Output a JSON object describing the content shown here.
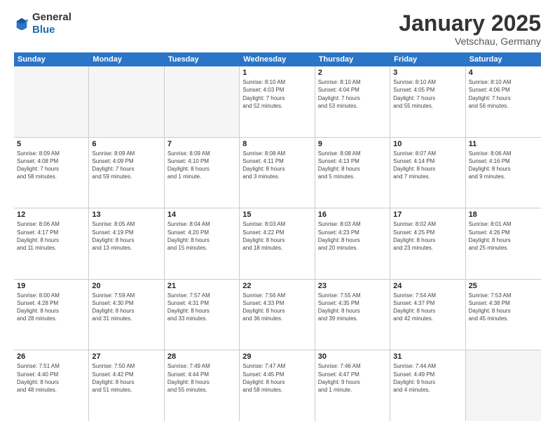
{
  "header": {
    "logo": {
      "general": "General",
      "blue": "Blue"
    },
    "title": "January 2025",
    "location": "Vetschau, Germany"
  },
  "calendar": {
    "weekdays": [
      "Sunday",
      "Monday",
      "Tuesday",
      "Wednesday",
      "Thursday",
      "Friday",
      "Saturday"
    ],
    "rows": [
      [
        {
          "day": "",
          "info": ""
        },
        {
          "day": "",
          "info": ""
        },
        {
          "day": "",
          "info": ""
        },
        {
          "day": "1",
          "info": "Sunrise: 8:10 AM\nSunset: 4:03 PM\nDaylight: 7 hours\nand 52 minutes."
        },
        {
          "day": "2",
          "info": "Sunrise: 8:10 AM\nSunset: 4:04 PM\nDaylight: 7 hours\nand 53 minutes."
        },
        {
          "day": "3",
          "info": "Sunrise: 8:10 AM\nSunset: 4:05 PM\nDaylight: 7 hours\nand 55 minutes."
        },
        {
          "day": "4",
          "info": "Sunrise: 8:10 AM\nSunset: 4:06 PM\nDaylight: 7 hours\nand 56 minutes."
        }
      ],
      [
        {
          "day": "5",
          "info": "Sunrise: 8:09 AM\nSunset: 4:08 PM\nDaylight: 7 hours\nand 58 minutes."
        },
        {
          "day": "6",
          "info": "Sunrise: 8:09 AM\nSunset: 4:09 PM\nDaylight: 7 hours\nand 59 minutes."
        },
        {
          "day": "7",
          "info": "Sunrise: 8:09 AM\nSunset: 4:10 PM\nDaylight: 8 hours\nand 1 minute."
        },
        {
          "day": "8",
          "info": "Sunrise: 8:08 AM\nSunset: 4:11 PM\nDaylight: 8 hours\nand 3 minutes."
        },
        {
          "day": "9",
          "info": "Sunrise: 8:08 AM\nSunset: 4:13 PM\nDaylight: 8 hours\nand 5 minutes."
        },
        {
          "day": "10",
          "info": "Sunrise: 8:07 AM\nSunset: 4:14 PM\nDaylight: 8 hours\nand 7 minutes."
        },
        {
          "day": "11",
          "info": "Sunrise: 8:06 AM\nSunset: 4:16 PM\nDaylight: 8 hours\nand 9 minutes."
        }
      ],
      [
        {
          "day": "12",
          "info": "Sunrise: 8:06 AM\nSunset: 4:17 PM\nDaylight: 8 hours\nand 11 minutes."
        },
        {
          "day": "13",
          "info": "Sunrise: 8:05 AM\nSunset: 4:19 PM\nDaylight: 8 hours\nand 13 minutes."
        },
        {
          "day": "14",
          "info": "Sunrise: 8:04 AM\nSunset: 4:20 PM\nDaylight: 8 hours\nand 15 minutes."
        },
        {
          "day": "15",
          "info": "Sunrise: 8:03 AM\nSunset: 4:22 PM\nDaylight: 8 hours\nand 18 minutes."
        },
        {
          "day": "16",
          "info": "Sunrise: 8:03 AM\nSunset: 4:23 PM\nDaylight: 8 hours\nand 20 minutes."
        },
        {
          "day": "17",
          "info": "Sunrise: 8:02 AM\nSunset: 4:25 PM\nDaylight: 8 hours\nand 23 minutes."
        },
        {
          "day": "18",
          "info": "Sunrise: 8:01 AM\nSunset: 4:26 PM\nDaylight: 8 hours\nand 25 minutes."
        }
      ],
      [
        {
          "day": "19",
          "info": "Sunrise: 8:00 AM\nSunset: 4:28 PM\nDaylight: 8 hours\nand 28 minutes."
        },
        {
          "day": "20",
          "info": "Sunrise: 7:59 AM\nSunset: 4:30 PM\nDaylight: 8 hours\nand 31 minutes."
        },
        {
          "day": "21",
          "info": "Sunrise: 7:57 AM\nSunset: 4:31 PM\nDaylight: 8 hours\nand 33 minutes."
        },
        {
          "day": "22",
          "info": "Sunrise: 7:56 AM\nSunset: 4:33 PM\nDaylight: 8 hours\nand 36 minutes."
        },
        {
          "day": "23",
          "info": "Sunrise: 7:55 AM\nSunset: 4:35 PM\nDaylight: 8 hours\nand 39 minutes."
        },
        {
          "day": "24",
          "info": "Sunrise: 7:54 AM\nSunset: 4:37 PM\nDaylight: 8 hours\nand 42 minutes."
        },
        {
          "day": "25",
          "info": "Sunrise: 7:53 AM\nSunset: 4:38 PM\nDaylight: 8 hours\nand 45 minutes."
        }
      ],
      [
        {
          "day": "26",
          "info": "Sunrise: 7:51 AM\nSunset: 4:40 PM\nDaylight: 8 hours\nand 48 minutes."
        },
        {
          "day": "27",
          "info": "Sunrise: 7:50 AM\nSunset: 4:42 PM\nDaylight: 8 hours\nand 51 minutes."
        },
        {
          "day": "28",
          "info": "Sunrise: 7:49 AM\nSunset: 4:44 PM\nDaylight: 8 hours\nand 55 minutes."
        },
        {
          "day": "29",
          "info": "Sunrise: 7:47 AM\nSunset: 4:45 PM\nDaylight: 8 hours\nand 58 minutes."
        },
        {
          "day": "30",
          "info": "Sunrise: 7:46 AM\nSunset: 4:47 PM\nDaylight: 9 hours\nand 1 minute."
        },
        {
          "day": "31",
          "info": "Sunrise: 7:44 AM\nSunset: 4:49 PM\nDaylight: 9 hours\nand 4 minutes."
        },
        {
          "day": "",
          "info": ""
        }
      ]
    ]
  }
}
